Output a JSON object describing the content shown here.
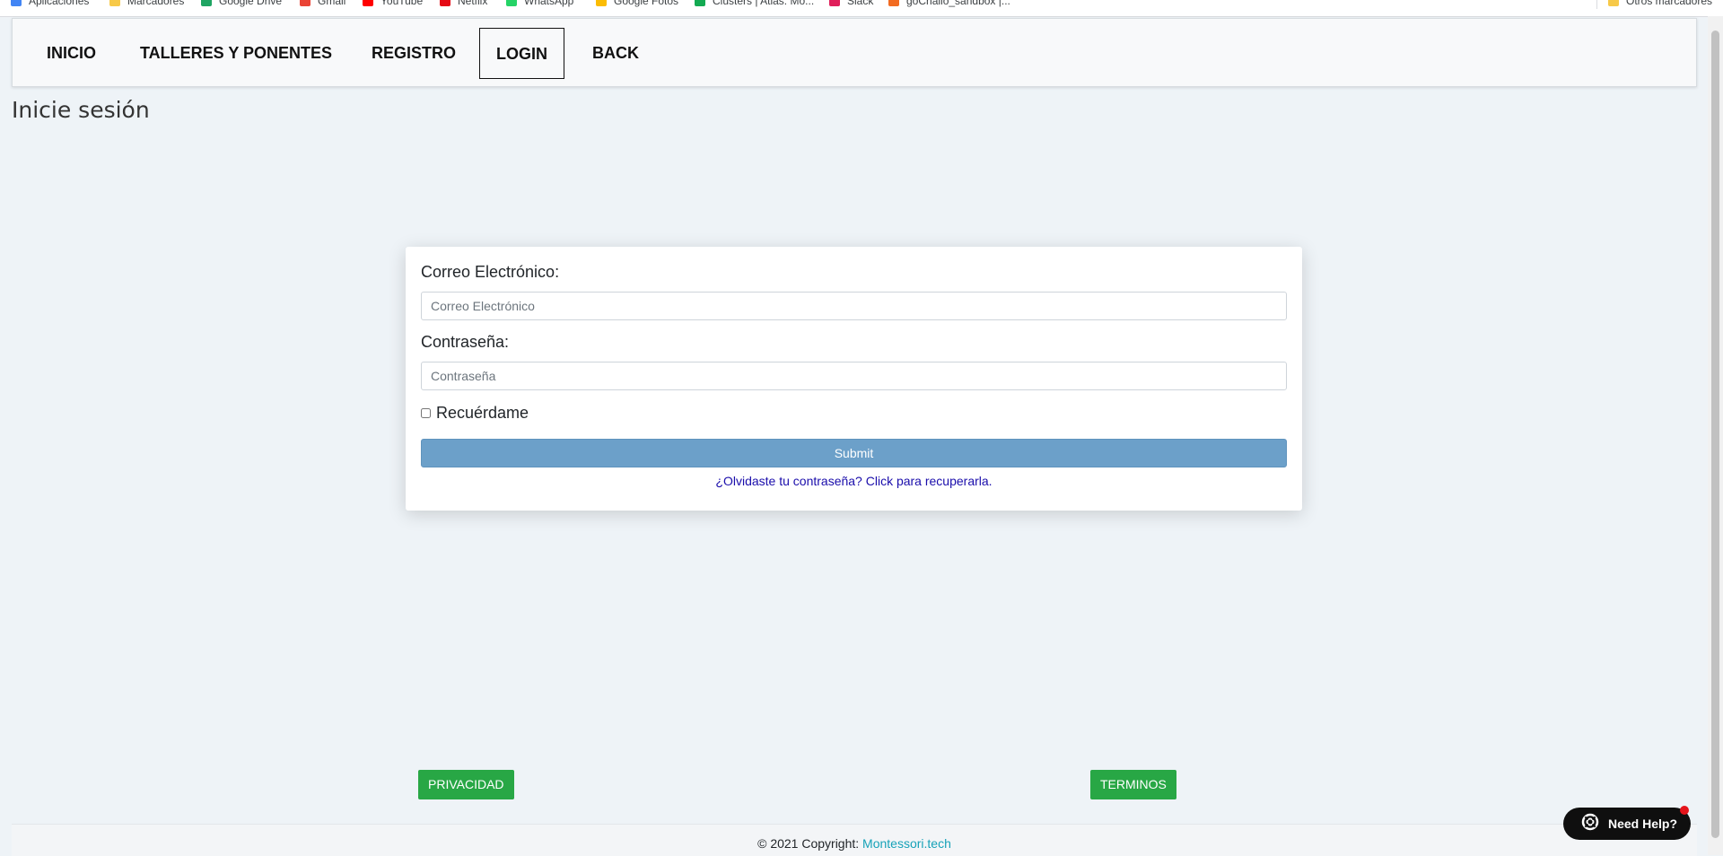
{
  "bookmarks": {
    "items": [
      {
        "label": "Aplicaciones",
        "icon": "apps-grid-icon",
        "color": "#4285f4"
      },
      {
        "label": "Marcadores",
        "icon": "folder-icon",
        "color": "#f7c948"
      },
      {
        "label": "Google Drive",
        "icon": "google-drive-icon",
        "color": "#1fa463"
      },
      {
        "label": "Gmail",
        "icon": "gmail-icon",
        "color": "#ea4335"
      },
      {
        "label": "YouTube",
        "icon": "youtube-icon",
        "color": "#ff0000"
      },
      {
        "label": "Netflix",
        "icon": "netflix-icon",
        "color": "#e50914"
      },
      {
        "label": "WhatsApp",
        "icon": "whatsapp-icon",
        "color": "#25d366"
      },
      {
        "label": "Google Fotos",
        "icon": "google-photos-icon",
        "color": "#fbbc04"
      },
      {
        "label": "Clusters | Atlas: Mo...",
        "icon": "mongodb-icon",
        "color": "#13aa52"
      },
      {
        "label": "Slack",
        "icon": "slack-icon",
        "color": "#e01e5a"
      },
      {
        "label": "goChallo_sandbox |...",
        "icon": "site-icon",
        "color": "#f26b21"
      }
    ],
    "other": {
      "label": "Otros marcadores",
      "icon": "folder-icon",
      "color": "#f7c948"
    }
  },
  "nav": {
    "items": [
      {
        "label": "INICIO",
        "active": false
      },
      {
        "label": "TALLERES Y PONENTES",
        "active": false
      },
      {
        "label": "REGISTRO",
        "active": false
      },
      {
        "label": "LOGIN",
        "active": true
      },
      {
        "label": "BACK",
        "active": false
      }
    ]
  },
  "page": {
    "title": "Inicie sesión"
  },
  "login": {
    "email_label": "Correo Electrónico:",
    "email_value": "",
    "email_placeholder": "Correo Electrónico",
    "password_label": "Contraseña:",
    "password_value": "",
    "password_placeholder": "Contraseña",
    "remember_label": "Recuérdame",
    "remember_checked": false,
    "submit_label": "Submit",
    "forgot_link": "¿Olvidaste tu contraseña? Click para recuperarla."
  },
  "footer": {
    "privacy_label": "PRIVACIDAD",
    "terms_label": "TERMINOS",
    "copyright_text": "© 2021 Copyright: ",
    "copyright_link": "Montessori.tech"
  },
  "help": {
    "label": "Need Help?",
    "icon": "lifebuoy-icon"
  },
  "colors": {
    "background": "#eef3f7",
    "submit": "#6ca0c9",
    "green": "#28a745",
    "link": "#1a0dab",
    "copyright_link": "#17a2b8"
  }
}
